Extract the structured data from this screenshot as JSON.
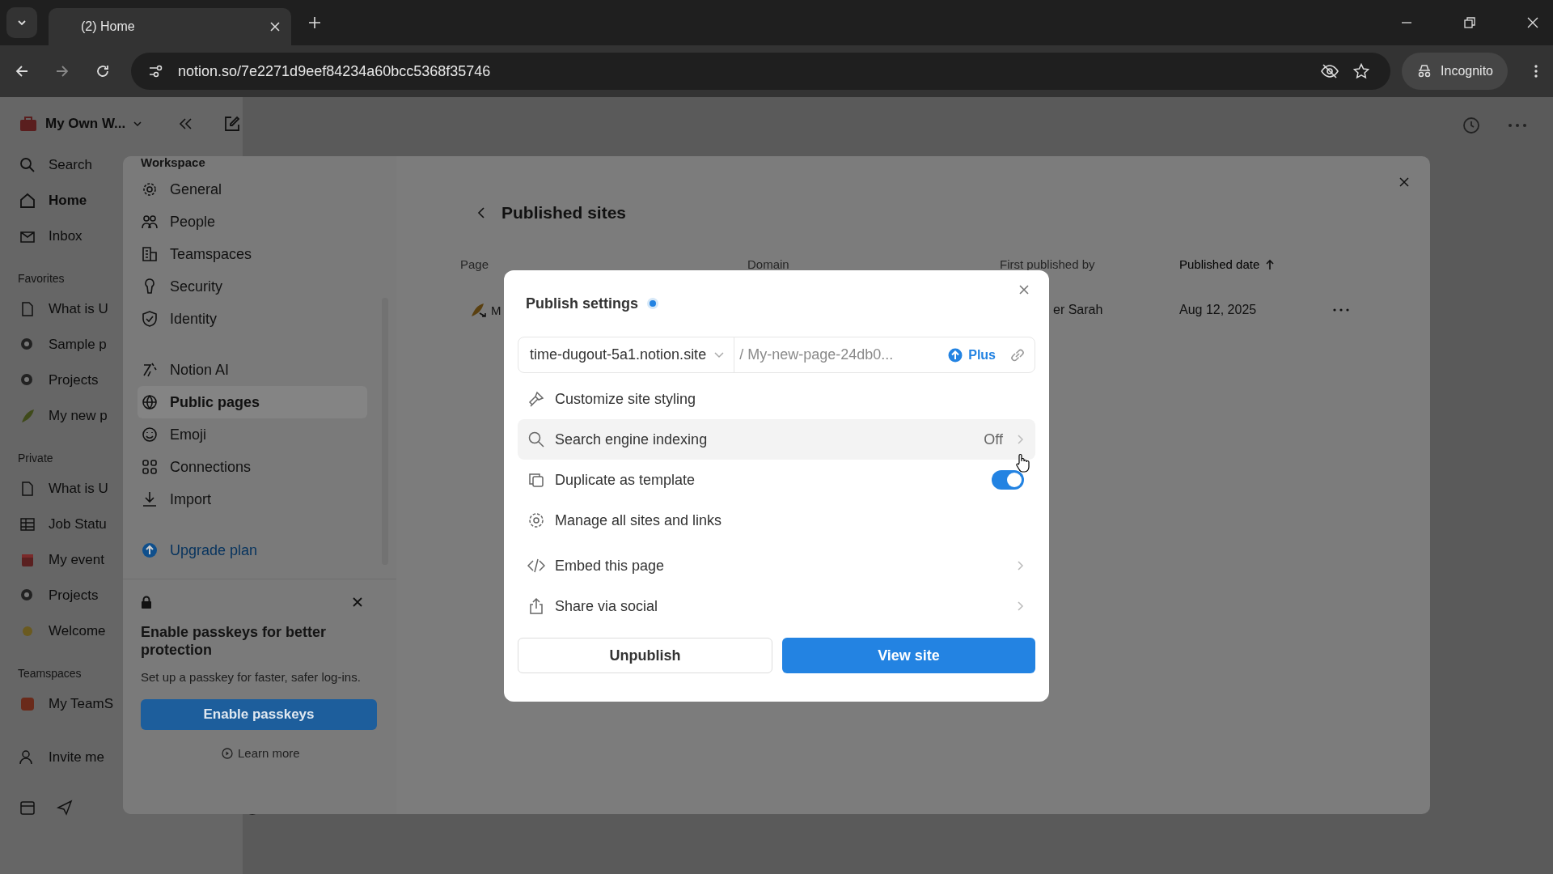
{
  "browser": {
    "tab_title": "(2) Home",
    "url": "notion.so/7e2271d9eef84234a60bcc5368f35746",
    "profile": "Incognito"
  },
  "sidebar": {
    "workspace": "My Own W...",
    "nav": [
      {
        "label": "Search"
      },
      {
        "label": "Home"
      },
      {
        "label": "Inbox"
      }
    ],
    "sections": [
      {
        "title": "Favorites",
        "items": [
          {
            "label": "What is U"
          },
          {
            "label": "Sample p"
          },
          {
            "label": "Projects"
          },
          {
            "label": "My new p"
          }
        ]
      },
      {
        "title": "Private",
        "items": [
          {
            "label": "What is U"
          },
          {
            "label": "Job Statu"
          },
          {
            "label": "My event"
          },
          {
            "label": "Projects"
          },
          {
            "label": "Welcome"
          }
        ]
      },
      {
        "title": "Teamspaces",
        "items": [
          {
            "label": "My TeamS"
          }
        ]
      }
    ],
    "footer": "Invite me"
  },
  "settings": {
    "section_title": "Workspace",
    "items": [
      {
        "label": "General",
        "selected": false
      },
      {
        "label": "People",
        "selected": false
      },
      {
        "label": "Teamspaces",
        "selected": false
      },
      {
        "label": "Security",
        "selected": false
      },
      {
        "label": "Identity",
        "selected": false
      },
      {
        "label": "Notion AI",
        "selected": false
      },
      {
        "label": "Public pages",
        "selected": true
      },
      {
        "label": "Emoji",
        "selected": false
      },
      {
        "label": "Connections",
        "selected": false
      },
      {
        "label": "Import",
        "selected": false
      }
    ],
    "upgrade": "Upgrade plan",
    "passkey_card": {
      "title": "Enable passkeys for better protection",
      "description": "Set up a passkey for faster, safer log-ins.",
      "button": "Enable passkeys",
      "link": "Learn more"
    },
    "page_title": "Published sites",
    "table": {
      "columns": [
        {
          "label": "Page",
          "sorted": false
        },
        {
          "label": "Domain",
          "sorted": false
        },
        {
          "label": "First published by",
          "sorted": false
        },
        {
          "label": "Published date",
          "sorted": true
        }
      ],
      "rows": [
        {
          "page": "M",
          "published_by": "er Sarah",
          "date": "Aug 12, 2025"
        }
      ]
    }
  },
  "publish_modal": {
    "title": "Publish settings",
    "live": true,
    "domain": "time-dugout-5a1.notion.site",
    "path": "/ My-new-page-24db0...",
    "plan_badge": "Plus",
    "options": [
      {
        "label": "Customize site styling",
        "kind": "link",
        "highlighted": false
      },
      {
        "label": "Search engine indexing",
        "kind": "value",
        "value": "Off",
        "highlighted": true
      },
      {
        "label": "Duplicate as template",
        "kind": "toggle",
        "on": true,
        "highlighted": false
      },
      {
        "label": "Manage all sites and links",
        "kind": "link",
        "highlighted": false
      },
      {
        "label": "Embed this page",
        "kind": "submenu",
        "highlighted": false
      },
      {
        "label": "Share via social",
        "kind": "submenu",
        "highlighted": false
      }
    ],
    "buttons": [
      {
        "label": "Unpublish",
        "kind": "secondary"
      },
      {
        "label": "View site",
        "kind": "primary"
      }
    ]
  }
}
